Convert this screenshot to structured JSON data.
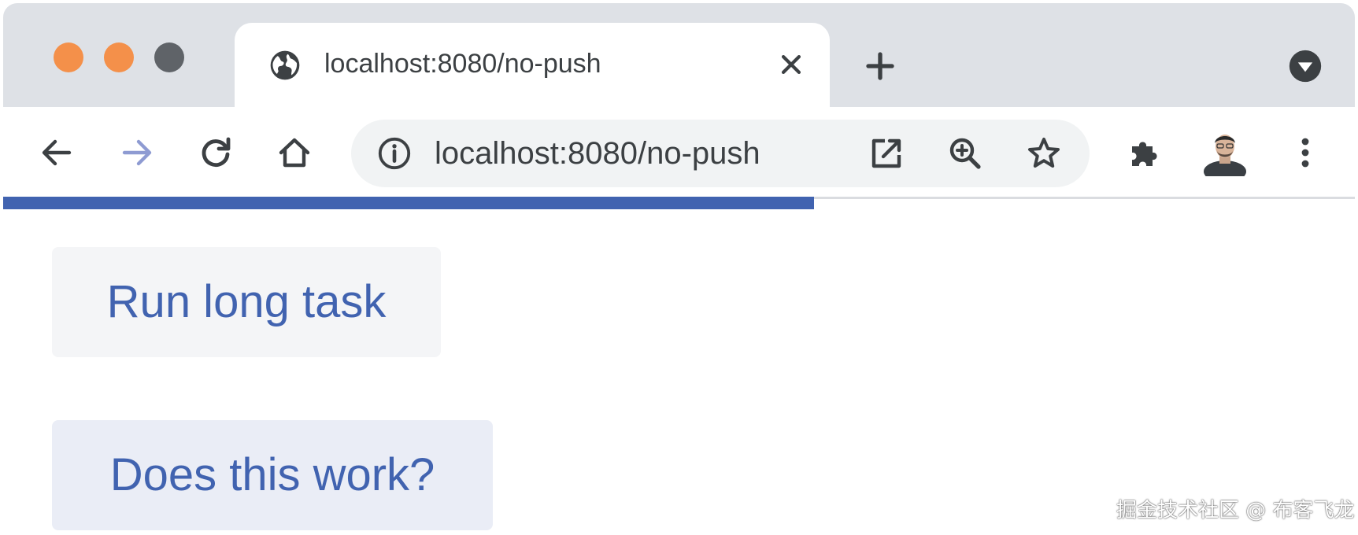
{
  "browser": {
    "tab": {
      "title": "localhost:8080/no-push",
      "favicon": "globe-icon"
    },
    "address_bar": {
      "url": "localhost:8080/no-push"
    },
    "page_load_progress": 0.6
  },
  "page": {
    "buttons": {
      "run_long_task": "Run long task",
      "does_this_work": "Does this work?"
    }
  },
  "watermark": "掘金技术社区 @ 布客飞龙",
  "colors": {
    "accent": "#4163b0",
    "traffic_light": "#f4904a",
    "tab_strip": "#dee1e6"
  }
}
